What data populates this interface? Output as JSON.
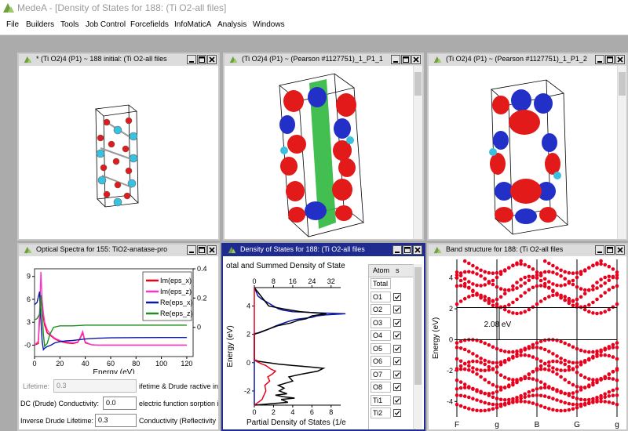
{
  "app": {
    "title": "MedeA - [Density of States for 188: (Ti O2-all files]",
    "brand_color": "#7fb14f"
  },
  "menu": [
    "File",
    "Builders",
    "Tools",
    "Job Control",
    "Forcefields",
    "InfoMaticA",
    "Analysis",
    "Windows"
  ],
  "windows": {
    "structure_initial": {
      "title": "* (Ti O2)4  (P1) ~ 188 initial: (Ti O2-all files"
    },
    "structure_p1_1": {
      "title": "(Ti O2)4  (P1) ~ (Pearson #1127751)_1_P1_1"
    },
    "structure_p1_2": {
      "title": "(Ti O2)4  (P1) ~ (Pearson #1127751)_1_P1_2"
    },
    "optical": {
      "title": "Optical Spectra for 155: TiO2-anatase-pro",
      "lifetime_label": "Lifetime:",
      "lifetime_value": "0.3",
      "lifetime_option": "ifetime & Drude",
      "dc_label": "DC (Drude) Conductivity:",
      "dc_value": "0.0",
      "dc_option": "electric function",
      "inverse_label": "Inverse Drude Lifetime:",
      "inverse_value": "0.3",
      "inverse_option": "Conductivity (Reflectivity",
      "col_fragment_1": "ractive inc",
      "col_fragment_2": "sorption in"
    },
    "dos": {
      "title": "Density of States for 188: (Ti O2-all files",
      "atom_header": "Atom",
      "s_header": "s",
      "atoms": [
        "Total",
        "O1",
        "O2",
        "O3",
        "O4",
        "O5",
        "O6",
        "O7",
        "O8",
        "Ti1",
        "Ti2"
      ],
      "checked": [
        false,
        true,
        true,
        true,
        true,
        true,
        true,
        true,
        true,
        true,
        true
      ]
    },
    "band": {
      "title": "Band structure for 188: (Ti O2-all files"
    }
  },
  "chart_data": [
    {
      "type": "line",
      "id": "optical",
      "xlabel": "Energy (eV)",
      "xlim": [
        0,
        125
      ],
      "xticks": [
        0,
        20,
        40,
        60,
        80,
        100,
        120
      ],
      "ylim_left": [
        -1.5,
        10
      ],
      "yticks_left": [
        0,
        3,
        6,
        9
      ],
      "ytick_labels_left": [
        "-0",
        "3",
        "6",
        "9"
      ],
      "ylim_right": [
        -0.2,
        0.4
      ],
      "yticks_right": [
        0,
        0.2,
        0.4
      ],
      "ytick_labels_right": [
        "0",
        "0.2",
        "0.4"
      ],
      "legend_position": "top-right",
      "series": [
        {
          "name": "Im(eps_x)",
          "color": "#e8001c",
          "axis": "left",
          "x": [
            0,
            3,
            4,
            5,
            6,
            7,
            8,
            10,
            13,
            16,
            20,
            25,
            30,
            34,
            36,
            38,
            40,
            45,
            50,
            60,
            80,
            100,
            120
          ],
          "y": [
            0,
            0.2,
            3.5,
            6.5,
            4.2,
            3.6,
            2.6,
            1.6,
            1.2,
            0.8,
            0.5,
            0.3,
            0.2,
            0.35,
            0.9,
            1.6,
            0.3,
            0.05,
            0,
            0,
            0,
            0,
            0
          ]
        },
        {
          "name": "Im(eps_z)",
          "color": "#ff33cc",
          "axis": "left",
          "x": [
            0,
            3,
            4,
            5,
            6,
            7,
            8,
            10,
            13,
            16,
            20,
            25,
            30,
            34,
            36,
            38,
            40,
            45,
            50,
            60,
            80,
            100,
            120
          ],
          "y": [
            0,
            0.5,
            4.5,
            9.6,
            5.8,
            4.2,
            3.0,
            2.0,
            1.3,
            0.9,
            0.6,
            0.4,
            0.3,
            0.4,
            1.0,
            1.8,
            0.4,
            0.05,
            0,
            0,
            0,
            0,
            0
          ]
        },
        {
          "name": "Re(eps_x)",
          "color": "#0b17a8",
          "axis": "left",
          "x": [
            0,
            2,
            3,
            4,
            5,
            6,
            7,
            8,
            10,
            13,
            16,
            20,
            25,
            30,
            35,
            40,
            50,
            60,
            80,
            100,
            120
          ],
          "y": [
            5.3,
            5.6,
            6.3,
            7.0,
            3.3,
            0.5,
            -0.6,
            -0.4,
            -0.2,
            0.0,
            0.3,
            0.45,
            0.55,
            0.6,
            0.7,
            0.8,
            0.9,
            0.95,
            0.98,
            1.0,
            1.0
          ]
        },
        {
          "name": "Re(eps_z)",
          "color": "#1f8e1f",
          "axis": "right",
          "x": [
            0,
            2,
            4,
            5,
            6,
            7,
            8,
            10,
            12,
            15,
            20,
            30,
            40,
            60,
            80,
            100,
            120
          ],
          "y": [
            0.05,
            0.06,
            0.09,
            0.22,
            0.1,
            -0.05,
            -0.13,
            -0.11,
            -0.05,
            0.0,
            0.01,
            0.01,
            0.015,
            0.015,
            0.015,
            0.015,
            0.015
          ]
        }
      ]
    },
    {
      "type": "line",
      "id": "dos",
      "title": "otal and Summed Density of State",
      "xlabel": "Partial Density of States (1/e",
      "ylabel": "Energy (eV)",
      "xlim_bottom": [
        0,
        9
      ],
      "xticks_bottom": [
        0,
        2,
        4,
        6,
        8
      ],
      "xlim_top": [
        0,
        36
      ],
      "xticks_top": [
        0,
        8,
        16,
        24,
        32
      ],
      "ylim": [
        -3,
        5.3
      ],
      "yticks": [
        -2,
        0,
        2,
        4
      ],
      "ytick_labels": [
        "-2",
        "0",
        "2",
        "4"
      ],
      "series": [
        {
          "name": "total",
          "color": "#0b17a8",
          "axis": "top",
          "y": [
            -3,
            2.05,
            2.1,
            2.3,
            2.6,
            2.9,
            3.05,
            3.2,
            3.3,
            3.38,
            3.45,
            3.52,
            3.6,
            3.7,
            3.8,
            4.0,
            4.2,
            4.35,
            4.5,
            4.7,
            5.3
          ],
          "x": [
            0,
            0,
            2,
            5,
            9,
            14,
            17,
            24,
            26,
            30,
            38,
            27,
            16,
            12,
            10,
            8,
            6,
            4.5,
            3,
            1.5,
            0
          ]
        },
        {
          "name": "black",
          "color": "#000000",
          "axis": "bottom",
          "y": [
            -3,
            -2.8,
            -2.6,
            -2.5,
            -2.4,
            -2.3,
            -2.2,
            -2.0,
            -1.8,
            -1.6,
            -1.3,
            -1.0,
            -0.8,
            -0.6,
            -0.4,
            -0.3,
            -0.2,
            -0.1,
            0,
            0.1,
            0.2,
            2.0,
            2.2,
            2.4,
            2.6,
            2.8,
            3.0,
            3.1,
            3.3,
            3.45,
            3.6,
            3.8,
            4.0,
            5.3
          ],
          "x": [
            0,
            3.5,
            2.8,
            4.2,
            3.0,
            2.2,
            3.4,
            2.6,
            3.1,
            2.5,
            4.0,
            3.6,
            5.0,
            6.6,
            7.2,
            5.8,
            4.0,
            2.5,
            1.4,
            0.4,
            0,
            0,
            0.8,
            1.6,
            2.4,
            3.8,
            4.6,
            5.4,
            6.0,
            7.5,
            4.8,
            3.0,
            1.5,
            0
          ]
        },
        {
          "name": "red",
          "color": "#e8001c",
          "axis": "bottom",
          "y": [
            -3,
            -2.6,
            -2.3,
            -2.0,
            -1.6,
            -1.3,
            -1.0,
            -0.8,
            -0.6,
            -0.45,
            -0.3,
            -0.2,
            -0.1,
            0,
            0.1,
            0.2,
            5.3
          ],
          "x": [
            0,
            0.8,
            1.0,
            1.2,
            1.1,
            1.6,
            1.4,
            1.9,
            2.2,
            1.7,
            1.4,
            1.2,
            0.8,
            0.5,
            0.2,
            0,
            0
          ]
        }
      ]
    },
    {
      "type": "scatter",
      "id": "band",
      "ylabel": "Energy (eV)",
      "ylim": [
        -5,
        5.2
      ],
      "yticks": [
        -4,
        -2,
        0,
        2,
        4
      ],
      "kpoints": [
        "F",
        "g",
        "B",
        "G",
        "g"
      ],
      "kpoint_positions": [
        0,
        0.25,
        0.5,
        0.75,
        1
      ],
      "gap_label": "2.08 eV",
      "gap_range": [
        0,
        2.08
      ],
      "point_color": "#e8001c",
      "bands": [
        {
          "e0": 2.3,
          "amp": 0.6,
          "ph": 0.0
        },
        {
          "e0": 2.8,
          "amp": 0.7,
          "ph": 1.3
        },
        {
          "e0": 3.3,
          "amp": 0.8,
          "ph": 2.1
        },
        {
          "e0": 3.8,
          "amp": 0.6,
          "ph": 0.7
        },
        {
          "e0": 4.2,
          "amp": 0.7,
          "ph": 2.9
        },
        {
          "e0": 4.8,
          "amp": 0.5,
          "ph": 1.9
        },
        {
          "e0": -0.4,
          "amp": 0.4,
          "ph": 0.5
        },
        {
          "e0": -1.0,
          "amp": 0.5,
          "ph": 1.7
        },
        {
          "e0": -1.5,
          "amp": 0.5,
          "ph": 2.6
        },
        {
          "e0": -2.0,
          "amp": 0.6,
          "ph": 0.2
        },
        {
          "e0": -2.5,
          "amp": 0.6,
          "ph": 1.1
        },
        {
          "e0": -3.0,
          "amp": 0.5,
          "ph": 2.3
        },
        {
          "e0": -3.5,
          "amp": 0.4,
          "ph": 0.9
        },
        {
          "e0": -3.9,
          "amp": 0.3,
          "ph": 1.6
        },
        {
          "e0": -4.3,
          "amp": 0.3,
          "ph": 2.8
        }
      ]
    }
  ]
}
